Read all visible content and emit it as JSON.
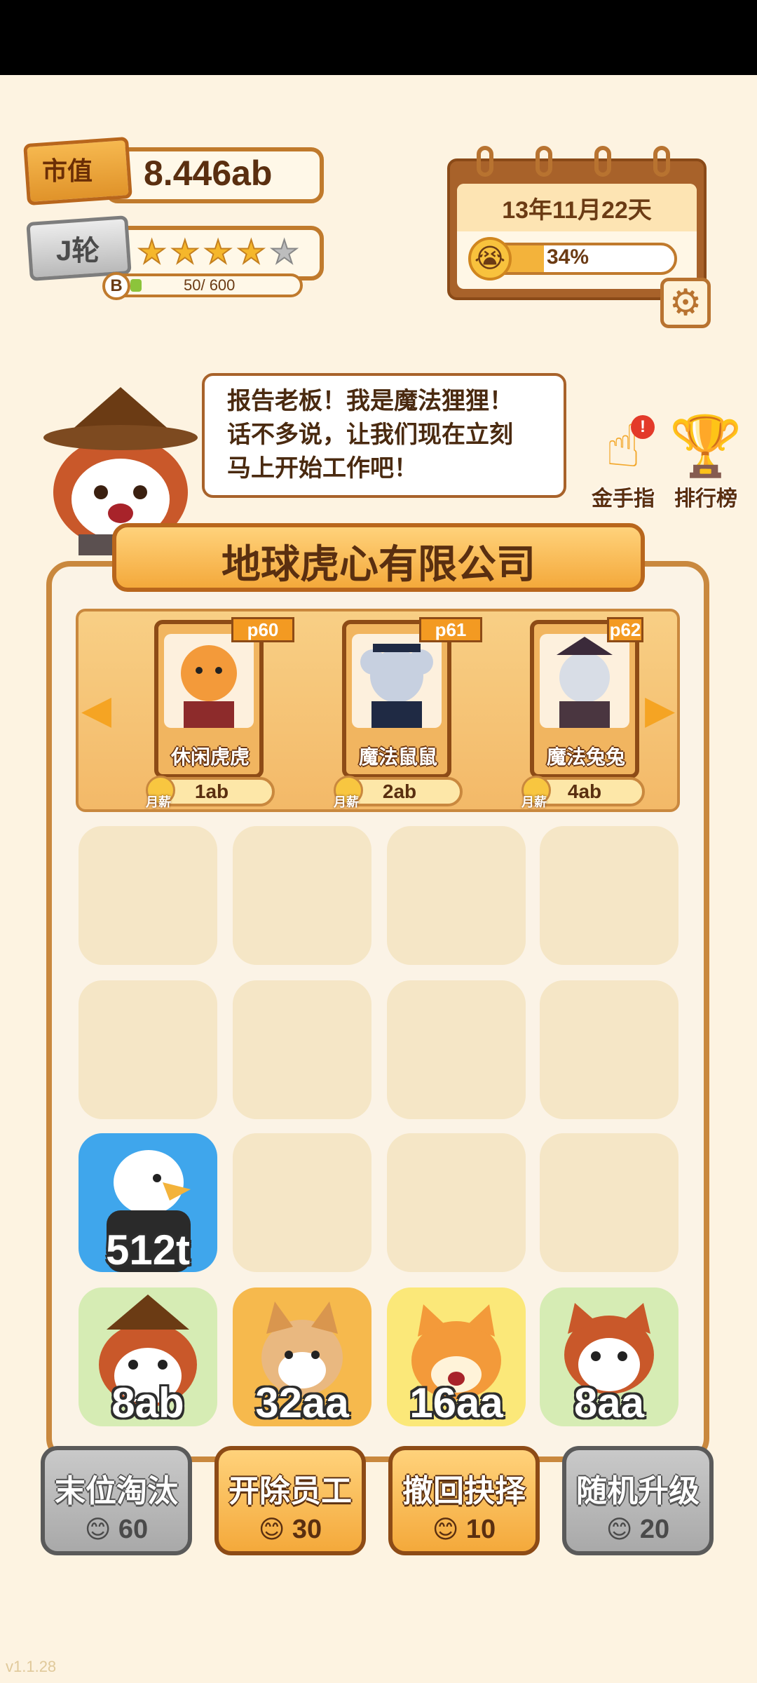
{
  "stats": {
    "market_label": "市值",
    "market_value": "8.446ab",
    "rank_label": "J轮",
    "stars_filled": 4,
    "stars_total": 5,
    "xp_badge": "B",
    "xp_text": "50/ 600"
  },
  "calendar": {
    "date": "13年11月22天",
    "percent": "34%",
    "progress": 0.34
  },
  "speech": {
    "text": "报告老板！我是魔法狸狸！\n话不多说，让我们现在立刻\n马上开始工作吧！"
  },
  "side_buttons": [
    {
      "label": "金手指",
      "icon": "pointing-hand-icon",
      "badge": "!"
    },
    {
      "label": "排行榜",
      "icon": "trophy-icon"
    }
  ],
  "company": {
    "name": "地球虎心有限公司"
  },
  "hire_cards": [
    {
      "tag": "p60",
      "name": "休闲虎虎",
      "price": "1ab",
      "coin_label": "月薪"
    },
    {
      "tag": "p61",
      "name": "魔法鼠鼠",
      "price": "2ab",
      "coin_label": "月薪"
    },
    {
      "tag": "p62",
      "name": "魔法兔兔",
      "price": "4ab",
      "coin_label": "月薪"
    }
  ],
  "tiles": [
    {
      "value": "512t",
      "kind": "eagle",
      "bg": "#3fa6ec"
    },
    {
      "value": "8ab",
      "kind": "raccoon-hat",
      "bg": "#d6ecb4"
    },
    {
      "value": "32aa",
      "kind": "shiba",
      "bg": "#f6b94d"
    },
    {
      "value": "16aa",
      "kind": "cat",
      "bg": "#fbe879"
    },
    {
      "value": "8aa",
      "kind": "raccoon",
      "bg": "#d6ecb4"
    }
  ],
  "actions": [
    {
      "label": "末位淘汰",
      "cost": "60",
      "style": "gray"
    },
    {
      "label": "开除员工",
      "cost": "30",
      "style": "gold"
    },
    {
      "label": "撤回抉择",
      "cost": "10",
      "style": "gold"
    },
    {
      "label": "随机升级",
      "cost": "20",
      "style": "gray"
    }
  ],
  "version": "v1.1.28",
  "colors": {
    "accent": "#f4a93b",
    "border": "#8d4b16",
    "background": "#fdf3e1"
  }
}
